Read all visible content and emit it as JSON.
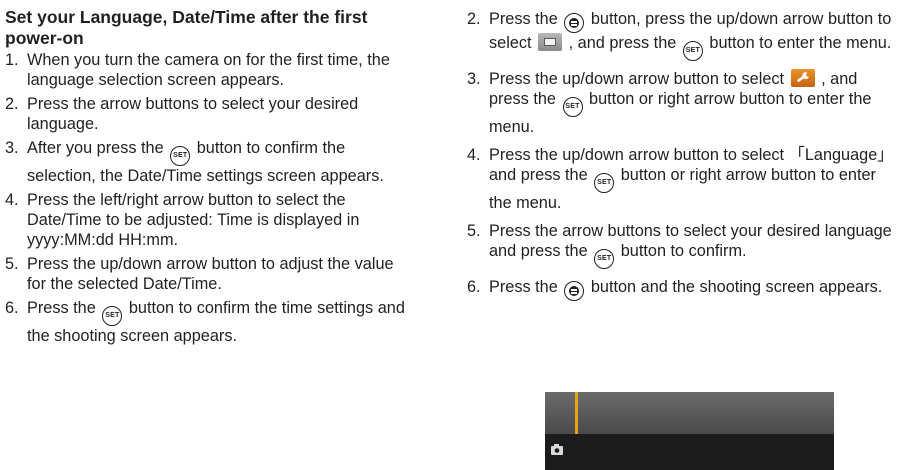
{
  "heading": "Set your Language, Date/Time after the first power-on",
  "left_steps": [
    {
      "num": "1.",
      "text": "When you turn the camera on for the first time, the language selection screen appears."
    },
    {
      "num": "2.",
      "text": "Press the arrow buttons to select your desired language."
    },
    {
      "num": "3.",
      "pre": "After you press the",
      "post": "button to confirm the selection, the Date/Time settings screen appears."
    },
    {
      "num": "4.",
      "text": "Press the left/right arrow button to select the Date/Time to be adjusted: Time is displayed in yyyy:MM:dd HH:mm."
    },
    {
      "num": "5.",
      "text": "Press the up/down arrow button to adjust the value for the selected Date/Time."
    },
    {
      "num": "6.",
      "pre": "Press the",
      "post": "button to confirm the time settings and the shooting screen appears."
    }
  ],
  "right_steps": [
    {
      "num": "2.",
      "a": "Press the",
      "b": "button, press the up/down arrow button to select",
      "c": ", and press the",
      "d": "button to enter the menu."
    },
    {
      "num": "3.",
      "a": "Press the up/down arrow button to select",
      "b": ", and press the",
      "c": "button or right arrow button to enter the menu."
    },
    {
      "num": "4.",
      "a": "Press the up/down arrow button to select 「Language」 and press the",
      "b": "button or right arrow button to enter the menu."
    },
    {
      "num": "5.",
      "a": "Press the arrow buttons to select your desired language and press the",
      "b": "button to confirm."
    },
    {
      "num": "6.",
      "a": "Press the",
      "b": "button and the shooting screen appears."
    }
  ],
  "icons": {
    "set_button_label": "SET",
    "menu_button": "menu-button-icon",
    "menu_tile": "menu-tile-icon",
    "wrench_tile": "wrench-setup-icon"
  },
  "colors": {
    "text": "#231f20",
    "accent_orange": "#e8952a",
    "screen_accent": "#e8a218"
  }
}
